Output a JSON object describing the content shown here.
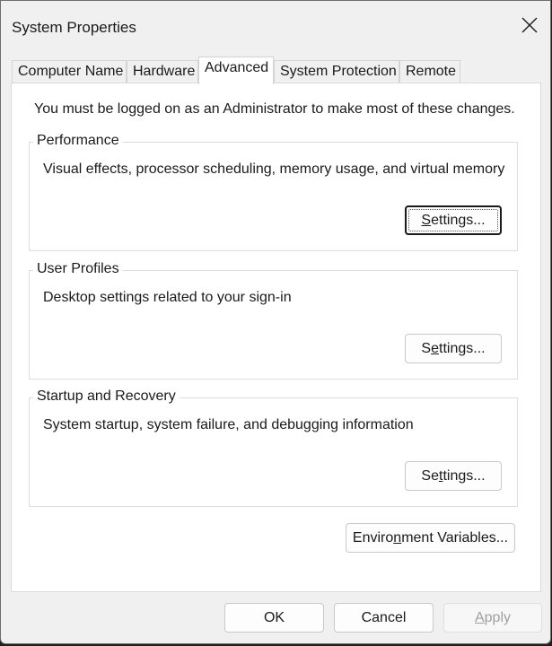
{
  "window": {
    "title": "System Properties",
    "close_icon": "close-icon"
  },
  "tabs": [
    {
      "label": "Computer Name",
      "active": false
    },
    {
      "label": "Hardware",
      "active": false
    },
    {
      "label": "Advanced",
      "active": true
    },
    {
      "label": "System Protection",
      "active": false
    },
    {
      "label": "Remote",
      "active": false
    }
  ],
  "advanced": {
    "admin_note": "You must be logged on as an Administrator to make most of these changes.",
    "performance": {
      "label": "Performance",
      "description": "Visual effects, processor scheduling, memory usage, and virtual memory",
      "settings_button": {
        "pre": "",
        "mnemonic": "S",
        "post": "ettings..."
      }
    },
    "user_profiles": {
      "label": "User Profiles",
      "description": "Desktop settings related to your sign-in",
      "settings_button": {
        "pre": "S",
        "mnemonic": "e",
        "post": "ttings..."
      }
    },
    "startup_recovery": {
      "label": "Startup and Recovery",
      "description": "System startup, system failure, and debugging information",
      "settings_button": {
        "pre": "Se",
        "mnemonic": "t",
        "post": "tings..."
      }
    },
    "env_button": {
      "pre": "Enviro",
      "mnemonic": "n",
      "post": "ment Variables..."
    }
  },
  "footer": {
    "ok": "OK",
    "cancel": "Cancel",
    "apply": {
      "pre": "",
      "mnemonic": "A",
      "post": "pply"
    }
  },
  "colors": {
    "window_bg": "#f0f0f0",
    "panel_bg": "#ffffff",
    "disabled_text": "#a0a0a0"
  }
}
